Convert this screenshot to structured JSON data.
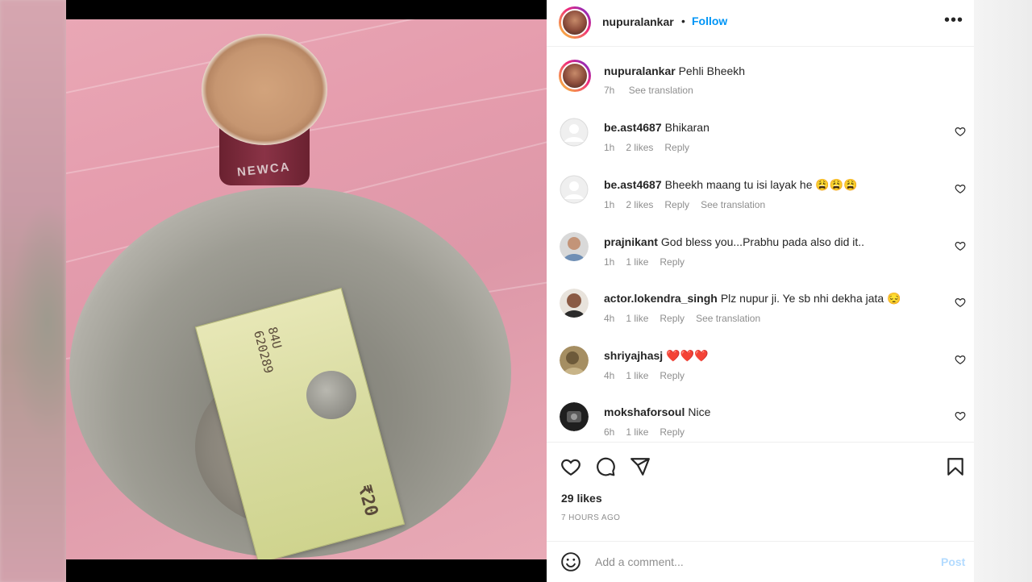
{
  "post": {
    "author": "nupuralankar",
    "follow_label": "Follow",
    "dot": "•",
    "more_label": "•••"
  },
  "photo": {
    "cup_print": "NEWCA",
    "note_serial": "84U 620289",
    "note_value": "₹20"
  },
  "caption": {
    "username": "nupuralankar",
    "text": "Pehli Bheekh",
    "time": "7h",
    "translate": "See translation"
  },
  "comments": [
    {
      "username": "be.ast4687",
      "text": "Bhikaran",
      "time": "1h",
      "likes": "2 likes",
      "reply": "Reply",
      "translate": ""
    },
    {
      "username": "be.ast4687",
      "text": "Bheekh maang tu isi layak he 😩😩😩",
      "time": "1h",
      "likes": "2 likes",
      "reply": "Reply",
      "translate": "See translation"
    },
    {
      "username": "prajnikant",
      "text": "God bless you...Prabhu pada also did it..",
      "time": "1h",
      "likes": "1 like",
      "reply": "Reply",
      "translate": ""
    },
    {
      "username": "actor.lokendra_singh",
      "text": "Plz nupur ji. Ye sb nhi dekha jata 😔",
      "time": "4h",
      "likes": "1 like",
      "reply": "Reply",
      "translate": "See translation"
    },
    {
      "username": "shriyajhasj",
      "text": "❤️❤️❤️",
      "time": "4h",
      "likes": "1 like",
      "reply": "Reply",
      "translate": ""
    },
    {
      "username": "mokshaforsoul",
      "text": "Nice",
      "time": "6h",
      "likes": "1 like",
      "reply": "Reply",
      "translate": ""
    }
  ],
  "stats": {
    "likes": "29 likes",
    "time_ago": "7 HOURS AGO"
  },
  "comment_box": {
    "placeholder": "Add a comment...",
    "post_label": "Post"
  },
  "icons": [
    "heart-icon",
    "comment-icon",
    "share-icon",
    "bookmark-icon",
    "emoji-icon",
    "more-icon"
  ],
  "colors": {
    "accent": "#0095f6",
    "post_disabled": "#b3dbff",
    "muted": "#8e8e8e",
    "text": "#262626"
  }
}
